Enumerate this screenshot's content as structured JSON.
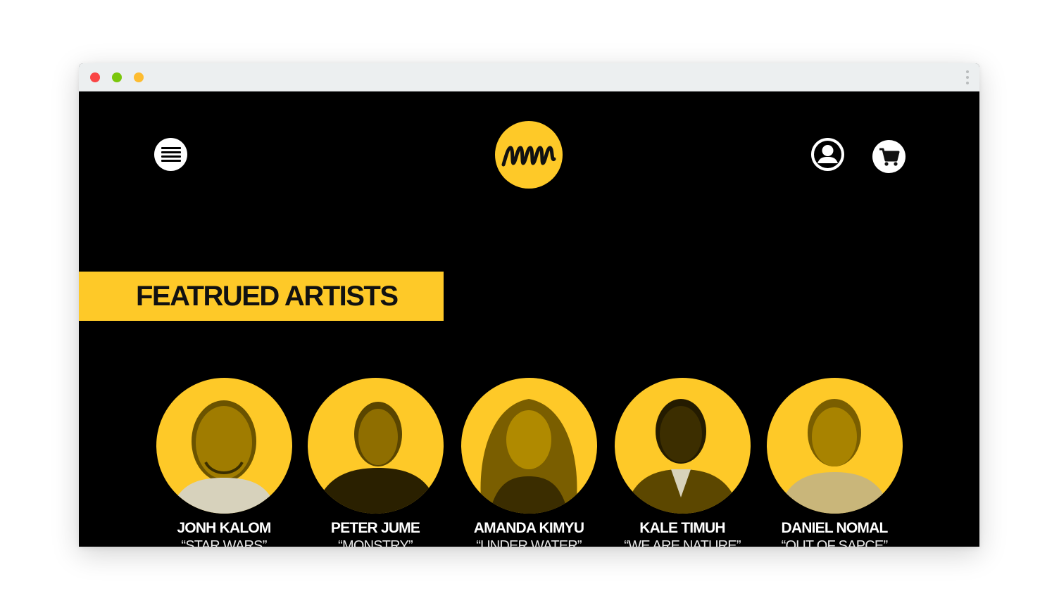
{
  "header": {
    "menu_icon": "hamburger-icon",
    "logo_text": "mm",
    "user_icon": "user-icon",
    "cart_icon": "cart-icon"
  },
  "colors": {
    "accent": "#fec928",
    "background": "#000000"
  },
  "featured": {
    "title": "FEATRUED ARTISTS",
    "artists": [
      {
        "name": "JONH KALOM",
        "work": "“STAR WARS”"
      },
      {
        "name": "PETER JUME",
        "work": "“MONSTRY”"
      },
      {
        "name": "AMANDA KIMYU",
        "work": "“UNDER WATER”"
      },
      {
        "name": "KALE TIMUH",
        "work": "“WE ARE NATURE”"
      },
      {
        "name": "DANIEL NOMAL",
        "work": "“OUT OF SAPCE”"
      }
    ]
  }
}
